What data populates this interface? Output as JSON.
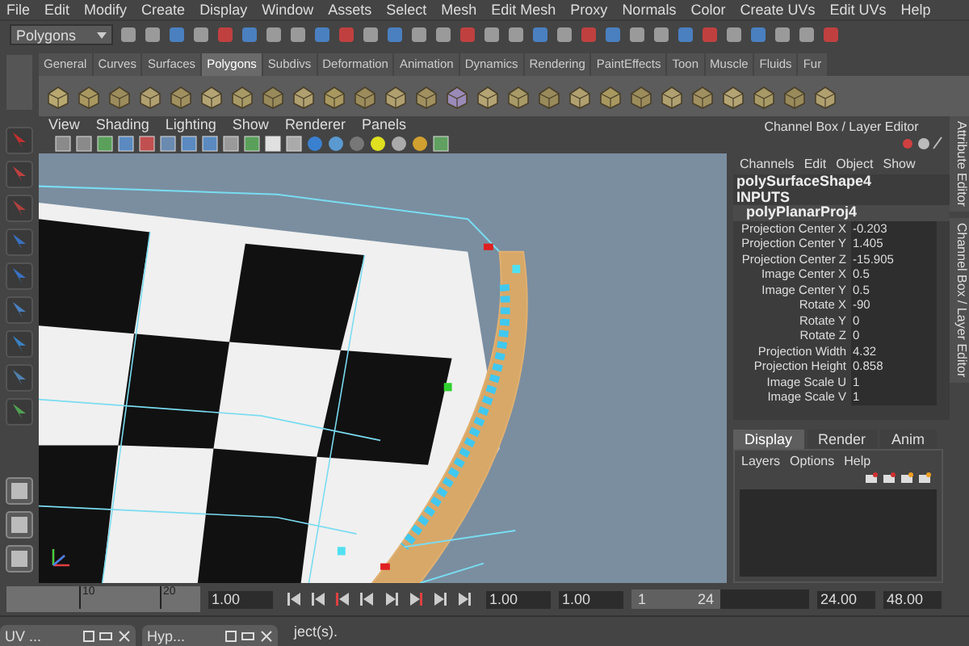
{
  "menu_bar": [
    "File",
    "Edit",
    "Modify",
    "Create",
    "Display",
    "Window",
    "Assets",
    "Select",
    "Mesh",
    "Edit Mesh",
    "Proxy",
    "Normals",
    "Color",
    "Create UVs",
    "Edit UVs",
    "Help"
  ],
  "mode_dropdown": {
    "value": "Polygons"
  },
  "shelf_tabs": [
    {
      "label": "General",
      "selected": false
    },
    {
      "label": "Curves",
      "selected": false
    },
    {
      "label": "Surfaces",
      "selected": false
    },
    {
      "label": "Polygons",
      "selected": true
    },
    {
      "label": "Subdivs",
      "selected": false
    },
    {
      "label": "Deformation",
      "selected": false
    },
    {
      "label": "Animation",
      "selected": false
    },
    {
      "label": "Dynamics",
      "selected": false
    },
    {
      "label": "Rendering",
      "selected": false
    },
    {
      "label": "PaintEffects",
      "selected": false
    },
    {
      "label": "Toon",
      "selected": false
    },
    {
      "label": "Muscle",
      "selected": false
    },
    {
      "label": "Fluids",
      "selected": false
    },
    {
      "label": "Fur",
      "selected": false
    }
  ],
  "viewport": {
    "menu": [
      "View",
      "Shading",
      "Lighting",
      "Show",
      "Renderer",
      "Panels"
    ]
  },
  "channel_box": {
    "title": "Channel Box / Layer Editor",
    "menu": [
      "Channels",
      "Edit",
      "Object",
      "Show"
    ],
    "shape": "polySurfaceShape4",
    "inputs_label": "INPUTS",
    "node": "polyPlanarProj4",
    "attributes": [
      {
        "name": "Projection Center X",
        "value": "-0.203"
      },
      {
        "name": "Projection Center Y",
        "value": "1.405"
      },
      {
        "name": "Projection Center Z",
        "value": "-15.905"
      },
      {
        "name": "Image Center X",
        "value": "0.5"
      },
      {
        "name": "Image Center Y",
        "value": "0.5"
      },
      {
        "name": "Rotate X",
        "value": "-90"
      },
      {
        "name": "Rotate Y",
        "value": "0"
      },
      {
        "name": "Rotate Z",
        "value": "0"
      },
      {
        "name": "Projection Width",
        "value": "4.32"
      },
      {
        "name": "Projection Height",
        "value": "0.858"
      },
      {
        "name": "Image Scale U",
        "value": "1"
      },
      {
        "name": "Image Scale V",
        "value": "1"
      }
    ]
  },
  "layer_editor": {
    "tabs": [
      {
        "label": "Display",
        "selected": true
      },
      {
        "label": "Render",
        "selected": false
      },
      {
        "label": "Anim",
        "selected": false
      }
    ],
    "menu": [
      "Layers",
      "Options",
      "Help"
    ]
  },
  "side_tabs": [
    "Attribute Editor",
    "Channel Box / Layer Editor"
  ],
  "timeline": {
    "ticks": [
      "10",
      "20"
    ],
    "current_time": "1.00",
    "start_time": "1.00",
    "range_start": "1.00",
    "range_slider": {
      "labels": [
        "1",
        "24"
      ],
      "level": 0.5
    },
    "range_end": "24.00",
    "end_time": "48.00"
  },
  "status_line": "ject(s).",
  "minimized_windows": [
    {
      "title": "UV ..."
    },
    {
      "title": "Hyp..."
    }
  ]
}
